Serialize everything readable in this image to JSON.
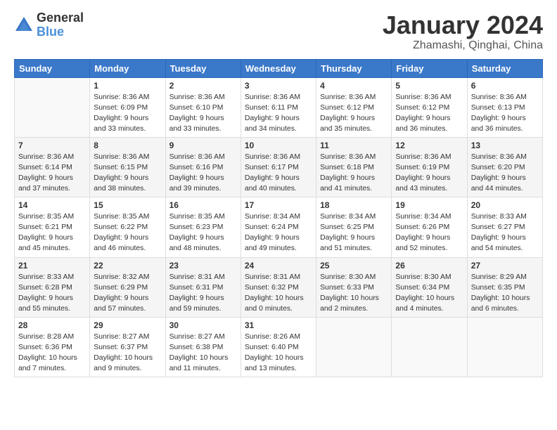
{
  "header": {
    "logo_general": "General",
    "logo_blue": "Blue",
    "month_title": "January 2024",
    "location": "Zhamashi, Qinghai, China"
  },
  "weekdays": [
    "Sunday",
    "Monday",
    "Tuesday",
    "Wednesday",
    "Thursday",
    "Friday",
    "Saturday"
  ],
  "weeks": [
    [
      {
        "day": "",
        "info": ""
      },
      {
        "day": "1",
        "info": "Sunrise: 8:36 AM\nSunset: 6:09 PM\nDaylight: 9 hours\nand 33 minutes."
      },
      {
        "day": "2",
        "info": "Sunrise: 8:36 AM\nSunset: 6:10 PM\nDaylight: 9 hours\nand 33 minutes."
      },
      {
        "day": "3",
        "info": "Sunrise: 8:36 AM\nSunset: 6:11 PM\nDaylight: 9 hours\nand 34 minutes."
      },
      {
        "day": "4",
        "info": "Sunrise: 8:36 AM\nSunset: 6:12 PM\nDaylight: 9 hours\nand 35 minutes."
      },
      {
        "day": "5",
        "info": "Sunrise: 8:36 AM\nSunset: 6:12 PM\nDaylight: 9 hours\nand 36 minutes."
      },
      {
        "day": "6",
        "info": "Sunrise: 8:36 AM\nSunset: 6:13 PM\nDaylight: 9 hours\nand 36 minutes."
      }
    ],
    [
      {
        "day": "7",
        "info": "Sunrise: 8:36 AM\nSunset: 6:14 PM\nDaylight: 9 hours\nand 37 minutes."
      },
      {
        "day": "8",
        "info": "Sunrise: 8:36 AM\nSunset: 6:15 PM\nDaylight: 9 hours\nand 38 minutes."
      },
      {
        "day": "9",
        "info": "Sunrise: 8:36 AM\nSunset: 6:16 PM\nDaylight: 9 hours\nand 39 minutes."
      },
      {
        "day": "10",
        "info": "Sunrise: 8:36 AM\nSunset: 6:17 PM\nDaylight: 9 hours\nand 40 minutes."
      },
      {
        "day": "11",
        "info": "Sunrise: 8:36 AM\nSunset: 6:18 PM\nDaylight: 9 hours\nand 41 minutes."
      },
      {
        "day": "12",
        "info": "Sunrise: 8:36 AM\nSunset: 6:19 PM\nDaylight: 9 hours\nand 43 minutes."
      },
      {
        "day": "13",
        "info": "Sunrise: 8:36 AM\nSunset: 6:20 PM\nDaylight: 9 hours\nand 44 minutes."
      }
    ],
    [
      {
        "day": "14",
        "info": "Sunrise: 8:35 AM\nSunset: 6:21 PM\nDaylight: 9 hours\nand 45 minutes."
      },
      {
        "day": "15",
        "info": "Sunrise: 8:35 AM\nSunset: 6:22 PM\nDaylight: 9 hours\nand 46 minutes."
      },
      {
        "day": "16",
        "info": "Sunrise: 8:35 AM\nSunset: 6:23 PM\nDaylight: 9 hours\nand 48 minutes."
      },
      {
        "day": "17",
        "info": "Sunrise: 8:34 AM\nSunset: 6:24 PM\nDaylight: 9 hours\nand 49 minutes."
      },
      {
        "day": "18",
        "info": "Sunrise: 8:34 AM\nSunset: 6:25 PM\nDaylight: 9 hours\nand 51 minutes."
      },
      {
        "day": "19",
        "info": "Sunrise: 8:34 AM\nSunset: 6:26 PM\nDaylight: 9 hours\nand 52 minutes."
      },
      {
        "day": "20",
        "info": "Sunrise: 8:33 AM\nSunset: 6:27 PM\nDaylight: 9 hours\nand 54 minutes."
      }
    ],
    [
      {
        "day": "21",
        "info": "Sunrise: 8:33 AM\nSunset: 6:28 PM\nDaylight: 9 hours\nand 55 minutes."
      },
      {
        "day": "22",
        "info": "Sunrise: 8:32 AM\nSunset: 6:29 PM\nDaylight: 9 hours\nand 57 minutes."
      },
      {
        "day": "23",
        "info": "Sunrise: 8:31 AM\nSunset: 6:31 PM\nDaylight: 9 hours\nand 59 minutes."
      },
      {
        "day": "24",
        "info": "Sunrise: 8:31 AM\nSunset: 6:32 PM\nDaylight: 10 hours\nand 0 minutes."
      },
      {
        "day": "25",
        "info": "Sunrise: 8:30 AM\nSunset: 6:33 PM\nDaylight: 10 hours\nand 2 minutes."
      },
      {
        "day": "26",
        "info": "Sunrise: 8:30 AM\nSunset: 6:34 PM\nDaylight: 10 hours\nand 4 minutes."
      },
      {
        "day": "27",
        "info": "Sunrise: 8:29 AM\nSunset: 6:35 PM\nDaylight: 10 hours\nand 6 minutes."
      }
    ],
    [
      {
        "day": "28",
        "info": "Sunrise: 8:28 AM\nSunset: 6:36 PM\nDaylight: 10 hours\nand 7 minutes."
      },
      {
        "day": "29",
        "info": "Sunrise: 8:27 AM\nSunset: 6:37 PM\nDaylight: 10 hours\nand 9 minutes."
      },
      {
        "day": "30",
        "info": "Sunrise: 8:27 AM\nSunset: 6:38 PM\nDaylight: 10 hours\nand 11 minutes."
      },
      {
        "day": "31",
        "info": "Sunrise: 8:26 AM\nSunset: 6:40 PM\nDaylight: 10 hours\nand 13 minutes."
      },
      {
        "day": "",
        "info": ""
      },
      {
        "day": "",
        "info": ""
      },
      {
        "day": "",
        "info": ""
      }
    ]
  ]
}
